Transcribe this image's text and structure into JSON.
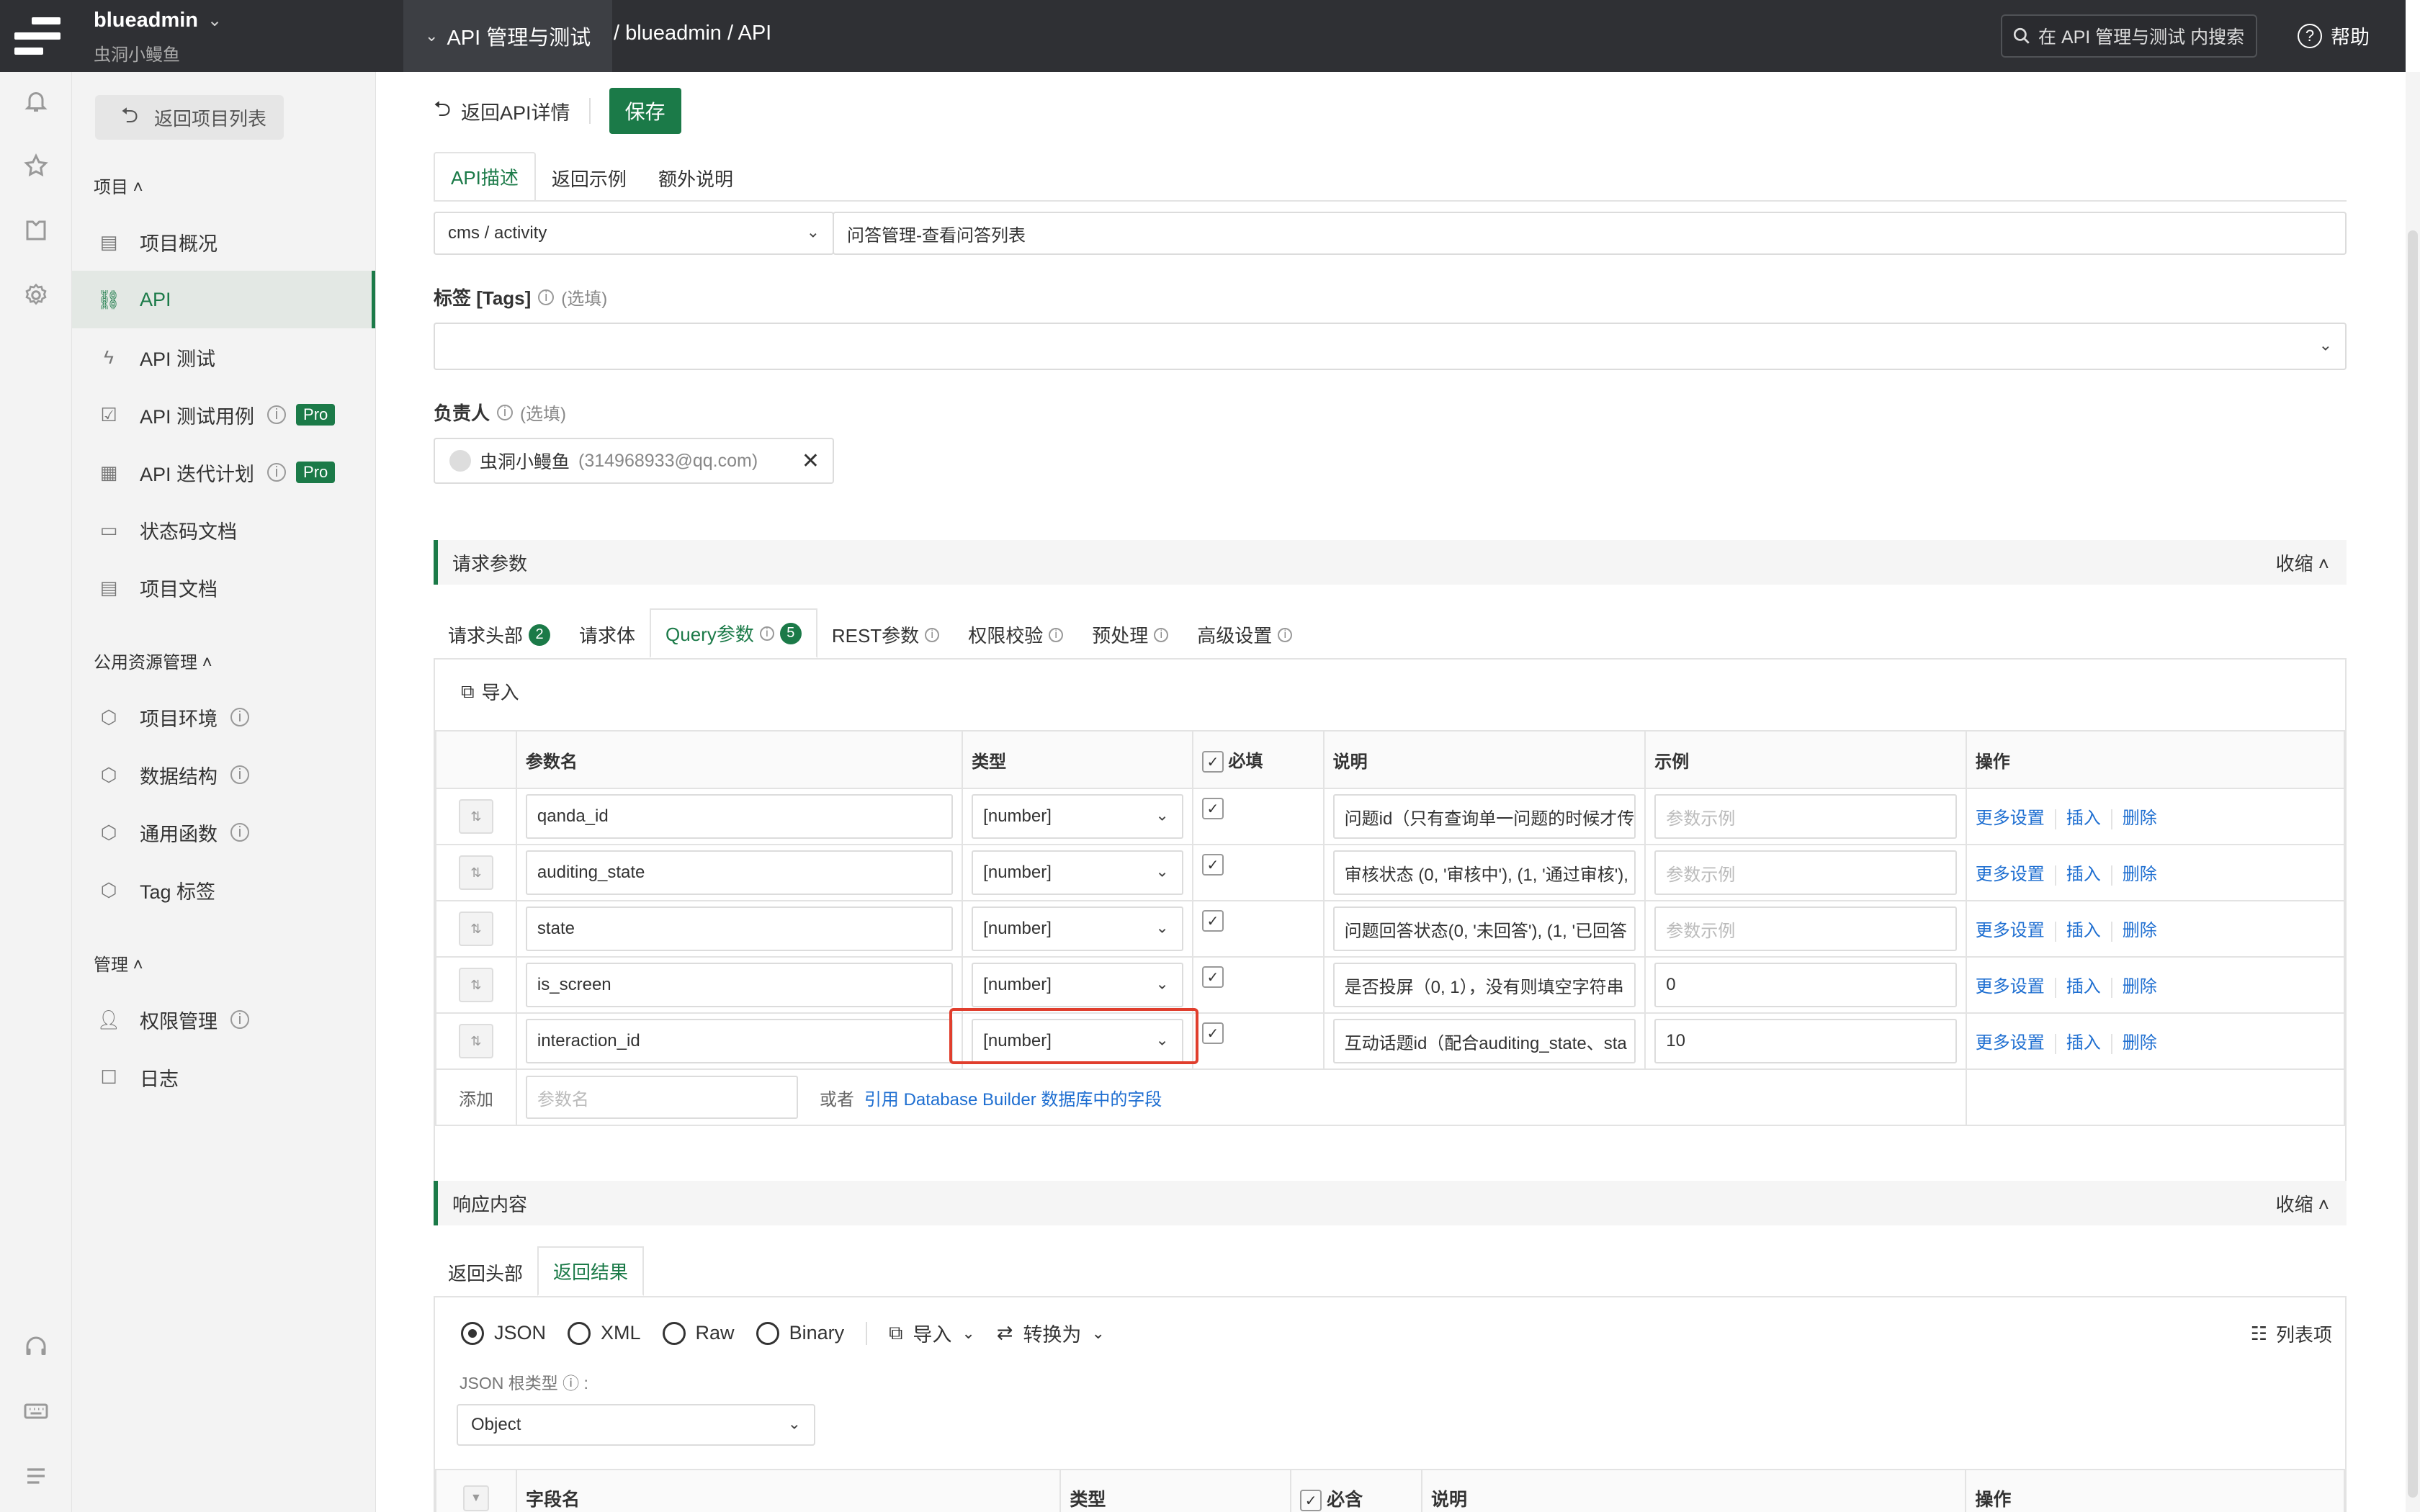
{
  "topbar": {
    "project_name": "blueadmin",
    "project_sub": "虫洞小鳗鱼",
    "module": "API 管理与测试",
    "breadcrumb": "/ blueadmin / API",
    "search_placeholder": "在 API 管理与测试 内搜索",
    "help": "帮助"
  },
  "sidebar": {
    "back_label": "返回项目列表",
    "sections": {
      "project": "项目",
      "public": "公用资源管理",
      "manage": "管理"
    },
    "items": {
      "overview": "项目概况",
      "api": "API",
      "api_test": "API 测试",
      "test_cases": "API 测试用例",
      "iteration": "API 迭代计划",
      "status_codes": "状态码文档",
      "docs": "项目文档",
      "env": "项目环境",
      "schema": "数据结构",
      "functions": "通用函数",
      "tags": "Tag 标签",
      "permissions": "权限管理",
      "logs": "日志"
    },
    "pro_label": "Pro"
  },
  "toolbar": {
    "back_label": "返回API详情",
    "save_label": "保存"
  },
  "top_tabs": [
    "API描述",
    "返回示例",
    "额外说明"
  ],
  "form": {
    "category": "cms / activity",
    "api_name": "问答管理-查看问答列表",
    "tags_label": "标签 [Tags]",
    "owner_label": "负责人",
    "optional": "(选填)",
    "owner_name": "虫洞小鳗鱼",
    "owner_email": "(314968933@qq.com)"
  },
  "request": {
    "title": "请求参数",
    "collapse": "收缩",
    "tabs": [
      {
        "label": "请求头部",
        "badge": "2"
      },
      {
        "label": "请求体",
        "badge": ""
      },
      {
        "label": "Query参数",
        "badge": "5"
      },
      {
        "label": "REST参数",
        "badge": ""
      },
      {
        "label": "权限校验",
        "badge": ""
      },
      {
        "label": "预处理",
        "badge": ""
      },
      {
        "label": "高级设置",
        "badge": ""
      }
    ],
    "import": "导入",
    "columns": {
      "name": "参数名",
      "type": "类型",
      "required": "必填",
      "desc": "说明",
      "example": "示例",
      "ops": "操作"
    },
    "example_placeholder": "参数示例",
    "ops": {
      "more": "更多设置",
      "insert": "插入",
      "delete": "删除"
    },
    "rows": [
      {
        "name": "qanda_id",
        "type": "[number]",
        "desc": "问题id（只有查询单一问题的时候才传",
        "example": ""
      },
      {
        "name": "auditing_state",
        "type": "[number]",
        "desc": "审核状态 (0, '审核中'), (1, '通过审核'),",
        "example": ""
      },
      {
        "name": "state",
        "type": "[number]",
        "desc": "问题回答状态(0, '未回答'), (1, '已回答",
        "example": ""
      },
      {
        "name": "is_screen",
        "type": "[number]",
        "desc": "是否投屏（0, 1），没有则填空字符串",
        "example": "0"
      },
      {
        "name": "interaction_id",
        "type": "[number]",
        "desc": "互动话题id（配合auditing_state、sta",
        "example": "10"
      }
    ],
    "add_label": "添加",
    "add_placeholder": "参数名",
    "or_label": "或者",
    "db_link": "引用 Database Builder 数据库中的字段"
  },
  "response": {
    "title": "响应内容",
    "collapse": "收缩",
    "tabs": [
      "返回头部",
      "返回结果"
    ],
    "formats": [
      "JSON",
      "XML",
      "Raw",
      "Binary"
    ],
    "import": "导入",
    "convert": "转换为",
    "column_items": "列表项",
    "root_type_label": "JSON 根类型",
    "root_type": "Object",
    "columns": {
      "field": "字段名",
      "type": "类型",
      "required": "必含",
      "desc": "说明",
      "ops": "操作"
    }
  }
}
